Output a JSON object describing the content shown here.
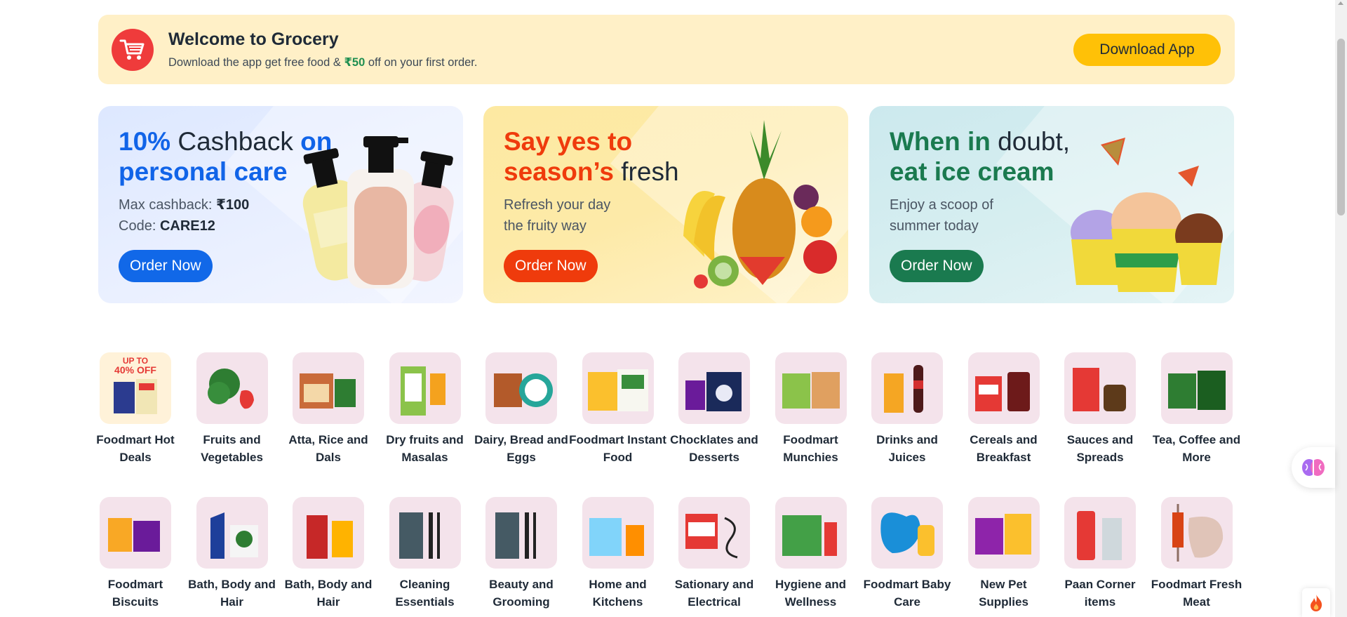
{
  "welcome": {
    "title": "Welcome to Grocery",
    "sub_before": "Download the app get free food & ",
    "sub_amount": "₹50",
    "sub_after": " off on your first order.",
    "download_label": "Download App"
  },
  "promos": [
    {
      "h_a": "10%",
      "h_b": " Cashback ",
      "h_c": "on personal care",
      "line1_a": "Max cashback: ",
      "line1_b": "₹100",
      "line2_a": "Code: ",
      "line2_b": "CARE12",
      "button": "Order Now"
    },
    {
      "h_a": "Say yes to season’s",
      "h_b": " fresh",
      "line1": "Refresh your day",
      "line2": "the fruity way",
      "button": "Order Now"
    },
    {
      "h_a": "When in",
      "h_b": " doubt,",
      "h_c": "eat ice cream",
      "line1": "Enjoy a scoop of",
      "line2": "summer today",
      "button": "Order Now"
    }
  ],
  "categories_row1": [
    {
      "label": "Foodmart Hot Deals",
      "tag": "UP TO",
      "tag2": "40% OFF"
    },
    {
      "label": "Fruits and Vegetables"
    },
    {
      "label": "Atta, Rice and Dals"
    },
    {
      "label": "Dry fruits and Masalas"
    },
    {
      "label": "Dairy, Bread and Eggs"
    },
    {
      "label": "Foodmart Instant Food"
    },
    {
      "label": "Chocklates and Desserts"
    },
    {
      "label": "Foodmart Munchies"
    },
    {
      "label": "Drinks and Juices"
    },
    {
      "label": "Cereals and Breakfast"
    },
    {
      "label": "Sauces and Spreads"
    },
    {
      "label": "Tea, Coffee and More"
    }
  ],
  "categories_row2": [
    {
      "label": "Foodmart Biscuits"
    },
    {
      "label": "Bath, Body and Hair"
    },
    {
      "label": "Bath, Body and Hair"
    },
    {
      "label": "Cleaning Essentials"
    },
    {
      "label": "Beauty and Grooming"
    },
    {
      "label": "Home and Kitchens"
    },
    {
      "label": "Sationary and Electrical"
    },
    {
      "label": "Hygiene and Wellness"
    },
    {
      "label": "Foodmart Baby Care"
    },
    {
      "label": "New Pet Supplies"
    },
    {
      "label": "Paan Corner items"
    },
    {
      "label": "Foodmart Fresh Meat"
    }
  ],
  "icons": {
    "cart": "shopping-cart-icon",
    "ai": "brain-icon",
    "fire": "fire-icon"
  },
  "colors": {
    "banner_bg": "#fff0c7",
    "download": "#ffc107",
    "blue": "#1164e8",
    "red": "#ef3b0c",
    "green": "#1a7a4f",
    "tile": "#f4e3eb"
  }
}
